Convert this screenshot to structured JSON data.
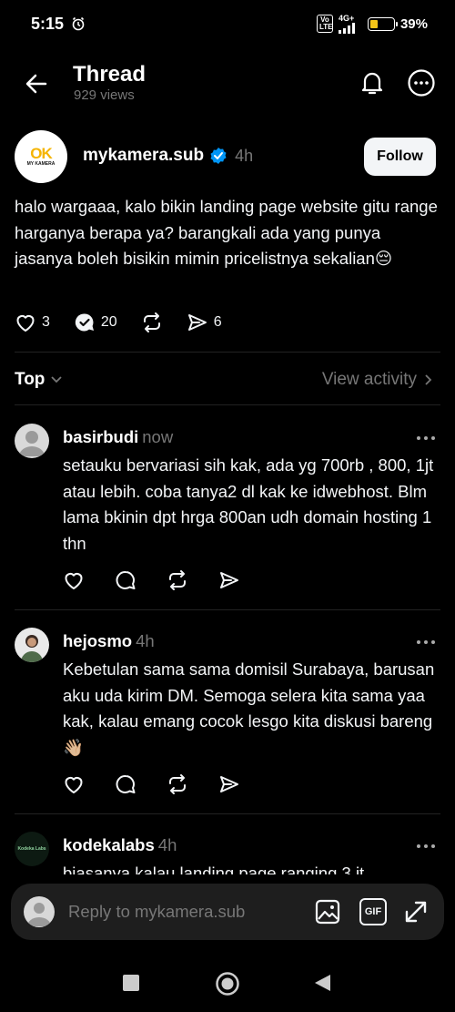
{
  "status": {
    "time": "5:15",
    "network": "4G+",
    "volte": "Vo LTE",
    "battery": "39%"
  },
  "header": {
    "title": "Thread",
    "views": "929 views"
  },
  "post": {
    "avatar_logo": "OK",
    "avatar_sub": "MY KAMERA",
    "author": "mykamera.sub",
    "time": "4h",
    "follow_label": "Follow",
    "text": "halo wargaaa, kalo bikin landing page website gitu range harganya berapa ya? barangkali ada yang punya jasanya boleh bisikin mimin pricelistnya sekalian",
    "emoji": "😔",
    "likes": "3",
    "replies": "20",
    "shares": "6"
  },
  "sort": {
    "label": "Top",
    "view_activity": "View activity"
  },
  "replies": [
    {
      "author": "basirbudi",
      "time": "now",
      "text": "setauku bervariasi sih kak, ada yg 700rb , 800, 1jt atau lebih. coba tanya2 dl kak ke idwebhost. Blm lama bkinin dpt hrga 800an udh domain hosting 1 thn"
    },
    {
      "author": "hejosmo",
      "time": "4h",
      "text": "Kebetulan sama sama domisil Surabaya, barusan aku uda kirim DM. Semoga selera kita sama yaa kak, kalau emang cocok lesgo kita diskusi bareng 👋🏼"
    },
    {
      "author": "kodekalabs",
      "time": "4h",
      "avatar_text": "Kodeka Labs",
      "text": "biasanya kalau landing page ranging 3 jt"
    }
  ],
  "reply_bar": {
    "placeholder": "Reply to mykamera.sub",
    "gif_label": "GIF"
  },
  "colors": {
    "background": "#000000",
    "text": "#f3f5f7",
    "muted": "#777777",
    "verified": "#0095f6",
    "battery": "#f5c518"
  }
}
